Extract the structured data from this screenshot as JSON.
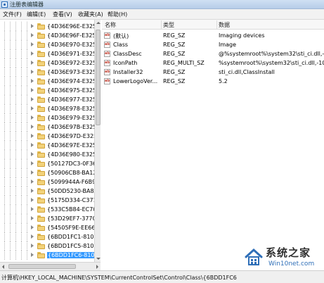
{
  "window": {
    "title": "注册表编辑器"
  },
  "menu": [
    "文件(F)",
    "编辑(E)",
    "查看(V)",
    "收藏夹(A)",
    "帮助(H)"
  ],
  "tree": {
    "selected_index": 27,
    "items": [
      "{4D36E96E-E325",
      "{4D36E96F-E325",
      "{4D36E970-E325",
      "{4D36E971-E325",
      "{4D36E972-E325",
      "{4D36E973-E325",
      "{4D36E974-E325",
      "{4D36E975-E325",
      "{4D36E977-E325",
      "{4D36E978-E325",
      "{4D36E979-E325",
      "{4D36E97B-E325",
      "{4D36E97D-E325",
      "{4D36E97E-E325",
      "{4D36E980-E325",
      "{50127DC3-0F36",
      "{50906CB8-BA12",
      "{5099944A-F6B9",
      "{50DD5230-BA8A",
      "{5175D334-C371",
      "{533C5B84-EC70",
      "{53D29EF7-377C",
      "{54505F9E-EE66",
      "{6BDD1FC1-810F",
      "{6BDD1FC5-810F",
      "{6BDD1FC6-810F"
    ]
  },
  "values": {
    "columns": {
      "name": "名称",
      "type": "类型",
      "data": "数据"
    },
    "rows": [
      {
        "name": "(默认)",
        "type": "REG_SZ",
        "data": "Imaging devices",
        "icon": "string-value-icon"
      },
      {
        "name": "Class",
        "type": "REG_SZ",
        "data": "Image",
        "icon": "string-value-icon"
      },
      {
        "name": "ClassDesc",
        "type": "REG_SZ",
        "data": "@%systemroot%\\system32\\sti_ci.dll,-5",
        "icon": "string-value-icon"
      },
      {
        "name": "IconPath",
        "type": "REG_MULTI_SZ",
        "data": "%systemroot%\\system32\\sti_ci.dll,-100",
        "icon": "string-value-icon"
      },
      {
        "name": "Installer32",
        "type": "REG_SZ",
        "data": "sti_ci.dll,ClassInstall",
        "icon": "string-value-icon"
      },
      {
        "name": "LowerLogoVer...",
        "type": "REG_SZ",
        "data": "5.2",
        "icon": "string-value-icon"
      }
    ]
  },
  "status": {
    "path": "计算机\\HKEY_LOCAL_MACHINE\\SYSTEM\\CurrentControlSet\\Control\\Class\\{6BDD1FC6"
  },
  "watermark": {
    "cn": "系统之家",
    "en": "Win10net.com"
  },
  "colors": {
    "selection": "#3399ff",
    "folder": "#f2d27a",
    "watermark_blue": "#2f6fb8"
  }
}
